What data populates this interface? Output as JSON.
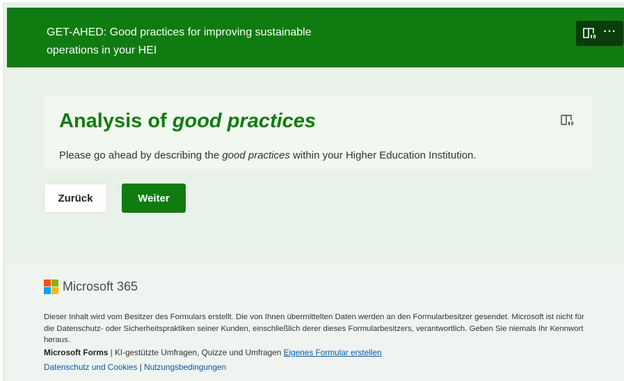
{
  "header": {
    "title": "GET-AHED: Good practices for improving sustainable operations in your HEI",
    "reader_icon": "immersive-reader-icon",
    "more_label": "···"
  },
  "section": {
    "title_plain": "Analysis of ",
    "title_italic": "good practices",
    "desc_before": "Please go ahead by describing the ",
    "desc_italic": "good practices",
    "desc_after": " within your Higher Education Institution.",
    "reader_icon": "immersive-reader-icon"
  },
  "nav": {
    "back_label": "Zurück",
    "next_label": "Weiter"
  },
  "footer": {
    "brand": "Microsoft 365",
    "disclaimer": "Dieser Inhalt wird vom Besitzer des Formulars erstellt. Die von Ihnen übermittelten Daten werden an den Formularbesitzer gesendet. Microsoft ist nicht für die Datenschutz- oder Sicherheitspraktiken seiner Kunden, einschließlich derer dieses Formularbesitzers, verantwortlich. Geben Sie niemals Ihr Kennwort heraus.",
    "forms_brand": "Microsoft Forms",
    "forms_sep": " | ",
    "forms_tagline": "KI-gestützte Umfragen, Quizze und Umfragen ",
    "create_link": "Eigenes Formular erstellen",
    "privacy_link": "Datenschutz und Cookies",
    "legal_sep": " | ",
    "terms_link": "Nutzungsbedingungen"
  },
  "colors": {
    "brand_green": "#107c10",
    "header_bg": "#0f7b10",
    "page_bg": "#e8f2e8",
    "link": "#0b57a4"
  }
}
